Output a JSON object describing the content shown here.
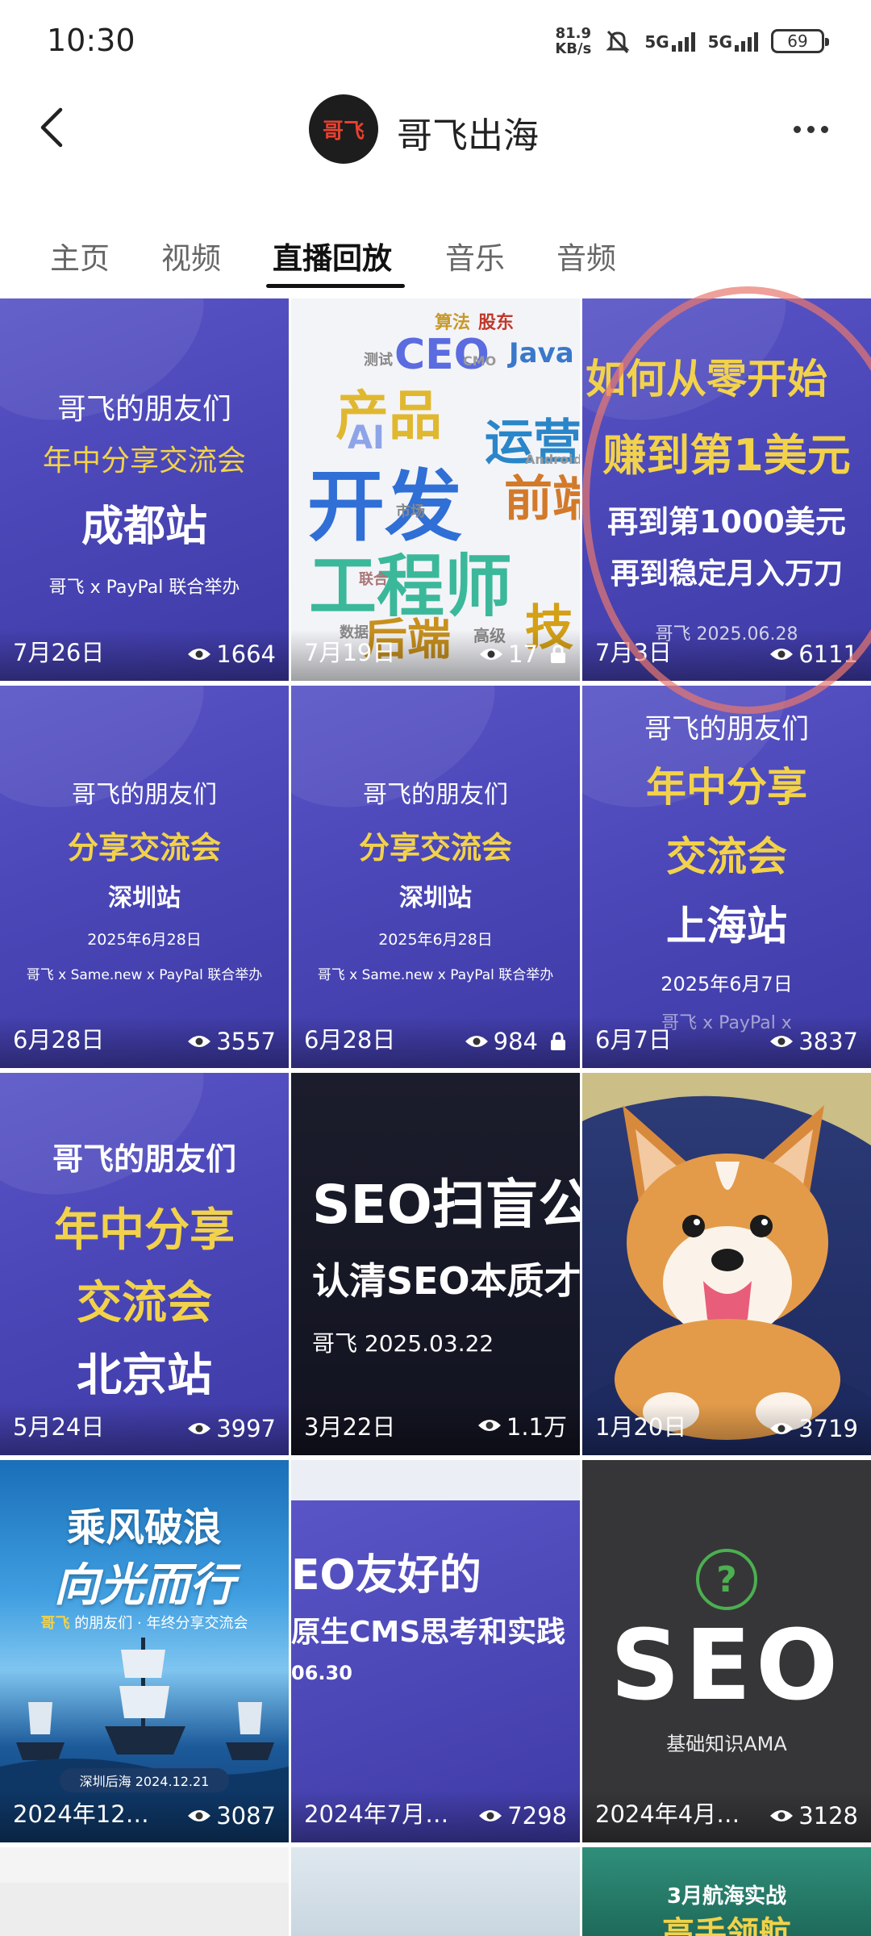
{
  "status_bar": {
    "time": "10:30",
    "net_speed_value": "81.9",
    "net_speed_unit": "KB/s",
    "signal1": "5G",
    "signal2": "5G",
    "battery": "69"
  },
  "header": {
    "avatar_text": "哥飞",
    "channel_name": "哥飞出海"
  },
  "tabs": [
    {
      "label": "主页"
    },
    {
      "label": "视频"
    },
    {
      "label": "直播回放",
      "active": true
    },
    {
      "label": "音乐"
    },
    {
      "label": "音频"
    }
  ],
  "tiles": [
    {
      "lines": [
        "哥飞的朋友们",
        "年中分享交流会",
        "成都站",
        "哥飞 x PayPal 联合举办"
      ],
      "date": "7月26日",
      "views": "1664",
      "locked": false
    },
    {
      "cloud_words": [
        "算法",
        "股东",
        "CEO",
        "Java",
        "产品",
        "运营",
        "AI",
        "开发",
        "前端",
        "工程师",
        "后端",
        "技",
        "CMO",
        "测试",
        "市场",
        "联合",
        "数据",
        "高级",
        "Android"
      ],
      "date": "7月19日",
      "views": "17",
      "locked": true
    },
    {
      "lines": [
        "如何从零开始",
        "赚到第1美元",
        "再到第1000美元",
        "再到稳定月入万刀",
        "哥飞 2025.06.28"
      ],
      "date": "7月3日",
      "views": "6111",
      "locked": false
    },
    {
      "lines": [
        "哥飞的朋友们",
        "分享交流会",
        "深圳站",
        "2025年6月28日",
        "哥飞 x Same.new x PayPal 联合举办"
      ],
      "date": "6月28日",
      "views": "3557",
      "locked": false
    },
    {
      "lines": [
        "哥飞的朋友们",
        "分享交流会",
        "深圳站",
        "2025年6月28日",
        "哥飞 x Same.new x PayPal 联合举办"
      ],
      "date": "6月28日",
      "views": "984",
      "locked": true
    },
    {
      "lines": [
        "哥飞的朋友们",
        "年中分享",
        "交流会",
        "上海站",
        "2025年6月7日",
        "哥飞 x PayPal x"
      ],
      "date": "6月7日",
      "views": "3837",
      "locked": false
    },
    {
      "lines": [
        "哥飞的朋友们",
        "年中分享",
        "交流会",
        "北京站"
      ],
      "date": "5月24日",
      "views": "3997",
      "locked": false
    },
    {
      "lines": [
        "SEO扫盲公",
        "认清SEO本质才",
        "哥飞 2025.03.22"
      ],
      "date": "3月22日",
      "views": "1.1万",
      "locked": false
    },
    {
      "lines": [],
      "date": "1月20日",
      "views": "3719",
      "locked": false
    },
    {
      "lines": [
        "乘风破浪",
        "向光而行",
        "哥飞",
        "的朋友们 · 年终分享交流会",
        "深圳后海  2024.12.21"
      ],
      "date": "2024年12…",
      "views": "3087",
      "locked": false
    },
    {
      "lines": [
        "EO友好的",
        "原生CMS思考和实践",
        "06.30"
      ],
      "date": "2024年7月…",
      "views": "7298",
      "locked": false
    },
    {
      "lines": [
        "?",
        "SEO",
        "基础知识AMA"
      ],
      "date": "2024年4月…",
      "views": "3128",
      "locked": false
    },
    {
      "lines": [
        "3月航海实战",
        "高手领航"
      ],
      "date": "",
      "views": "",
      "locked": false
    }
  ],
  "colors": {
    "title_yellow": "#f2d24a",
    "tile_purple": "#4b47b8",
    "annotation": "#e8786e"
  }
}
